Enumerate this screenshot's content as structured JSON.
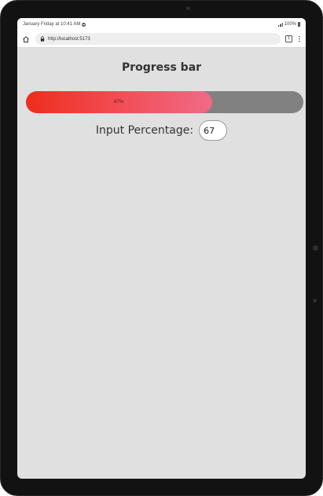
{
  "status_bar": {
    "time_text": "January Friday at 10:41 AM",
    "battery_text": "100%"
  },
  "browser": {
    "url": "http://localhost:5173",
    "tab_count": "1"
  },
  "page": {
    "title": "Progress bar",
    "progress": {
      "value_percent": 67,
      "label": "67%",
      "fill_gradient_start": "#ee2d1d",
      "fill_gradient_end": "#f06a87",
      "track_color": "#818181"
    },
    "input": {
      "label": "Input Percentage:",
      "value": "67"
    }
  },
  "colors": {
    "page_background": "#e0e0e0",
    "device_frame": "#121212"
  },
  "icons": [
    "home-icon",
    "lock-icon",
    "tabs-icon",
    "menu-icon",
    "dnd-icon",
    "signal-icon",
    "battery-icon"
  ]
}
